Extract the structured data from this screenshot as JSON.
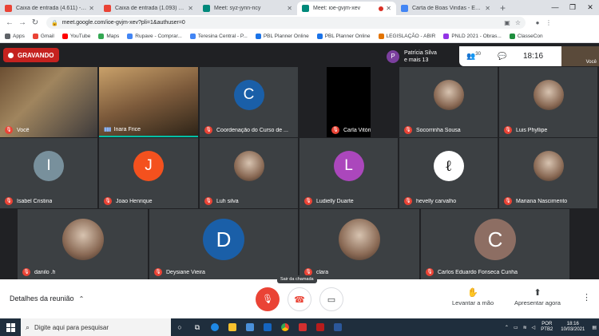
{
  "browser": {
    "tabs": [
      {
        "label": "Caixa de entrada (4.611) - robs",
        "favicon_color": "#ea4335",
        "active": false
      },
      {
        "label": "Caixa de entrada (1.093) - den",
        "favicon_color": "#ea4335",
        "active": false
      },
      {
        "label": "Meet: syz-jynn-ncy",
        "favicon_color": "#00897b",
        "active": false
      },
      {
        "label": "Meet: ioe-gvjm-xev",
        "favicon_color": "#00897b",
        "active": true,
        "recording": true
      },
      {
        "label": "Carta de Boas Vindas - Escola",
        "favicon_color": "#4285f4",
        "active": false
      }
    ],
    "url": "meet.google.com/ioe-gvjm-xev?pli=1&authuser=0",
    "bookmarks": [
      {
        "label": "Apps",
        "color": "#5f6368"
      },
      {
        "label": "Gmail",
        "color": "#ea4335"
      },
      {
        "label": "YouTube",
        "color": "#ff0000"
      },
      {
        "label": "Maps",
        "color": "#34a853"
      },
      {
        "label": "Rupave - Comprar...",
        "color": "#4285f4"
      },
      {
        "label": "Teresina Central - P...",
        "color": "#4285f4"
      },
      {
        "label": "PBL Planner Online",
        "color": "#1a73e8"
      },
      {
        "label": "PBL Planner Online",
        "color": "#1a73e8"
      },
      {
        "label": "LEGISLAÇÃO - ABIR",
        "color": "#e37400"
      },
      {
        "label": "PNLD 2021 - Obras...",
        "color": "#9334e6"
      },
      {
        "label": "ClasseCon",
        "color": "#1e8e3e"
      }
    ]
  },
  "meet": {
    "recording_label": "GRAVANDO",
    "presenter": {
      "initial": "P",
      "line1": "Patrícia Silva",
      "line2": "e mais 13"
    },
    "participants_count": "30",
    "clock": "18:16",
    "self_label": "Você",
    "tiles": [
      {
        "name": "Você",
        "kind": "photo1",
        "muted": true
      },
      {
        "name": "Inara Frice",
        "kind": "photo2",
        "muted": false,
        "speaking": true
      },
      {
        "name": "Coordenação do Curso de ...",
        "kind": "letter",
        "letter": "C",
        "color": "#1a5fa8",
        "muted": true
      },
      {
        "name": "Carla Vitória Sousa",
        "kind": "black",
        "muted": true
      },
      {
        "name": "Socorrinha Sousa",
        "kind": "img",
        "muted": true
      },
      {
        "name": "Luis Phyllipe",
        "kind": "img",
        "muted": true
      },
      {
        "name": "Isabel Cristina",
        "kind": "letter",
        "letter": "I",
        "color": "#78909c",
        "muted": true
      },
      {
        "name": "Joao Henrique",
        "kind": "letter",
        "letter": "J",
        "color": "#f4511e",
        "muted": true
      },
      {
        "name": "Luh silva",
        "kind": "img",
        "muted": true
      },
      {
        "name": "Ludielly Duarte",
        "kind": "letter",
        "letter": "L",
        "color": "#ab47bc",
        "muted": true
      },
      {
        "name": "hevelly carvalho",
        "kind": "logo",
        "muted": true
      },
      {
        "name": "Mariana Nascimento",
        "kind": "img",
        "muted": true
      },
      {
        "name": "danilo .h",
        "kind": "img",
        "muted": true
      },
      {
        "name": "Deysiane Vieira",
        "kind": "letter",
        "letter": "D",
        "color": "#1a5fa8",
        "muted": true
      },
      {
        "name": "clara",
        "kind": "img",
        "muted": true
      },
      {
        "name": "Carlos Eduardo Fonseca Cunha",
        "kind": "letter",
        "letter": "C",
        "color": "#8d6e63",
        "muted": true
      }
    ]
  },
  "toolbar": {
    "details_label": "Detalhes da reunião",
    "tooltip": "Sair da chamada",
    "raise_hand_label": "Levantar a mão",
    "present_label": "Apresentar agora"
  },
  "taskbar": {
    "search_placeholder": "Digite aqui para pesquisar",
    "lang_line1": "POR",
    "lang_line2": "PTB2",
    "time": "18:16",
    "date": "10/03/2021"
  }
}
